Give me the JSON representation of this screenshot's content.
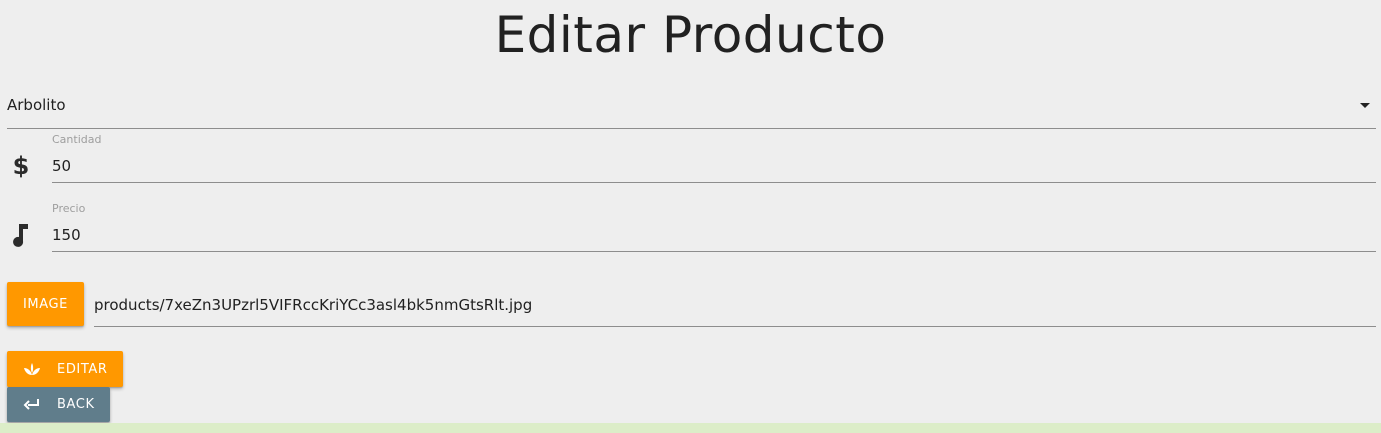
{
  "page": {
    "title": "Editar Producto"
  },
  "product_select": {
    "value": "Arbolito",
    "icon": "arrow-drop-down-icon"
  },
  "cantidad": {
    "label": "Cantidad",
    "value": "50",
    "icon": "dollar-icon"
  },
  "precio": {
    "label": "Precio",
    "value": "150",
    "icon": "music-note-icon"
  },
  "image": {
    "button_label": "IMAGE",
    "file_path": "products/7xeZn3UPzrl5VIFRccKriYCc3asl4bk5nmGtsRlt.jpg"
  },
  "actions": {
    "editar_label": "EDITAR",
    "editar_icon": "spa-icon",
    "back_label": "BACK",
    "back_icon": "keyboard-return-icon"
  },
  "colors": {
    "accent": "#ff9800",
    "secondary": "#607d8b",
    "background": "#eeeeee",
    "footer": "#dcedc8"
  }
}
